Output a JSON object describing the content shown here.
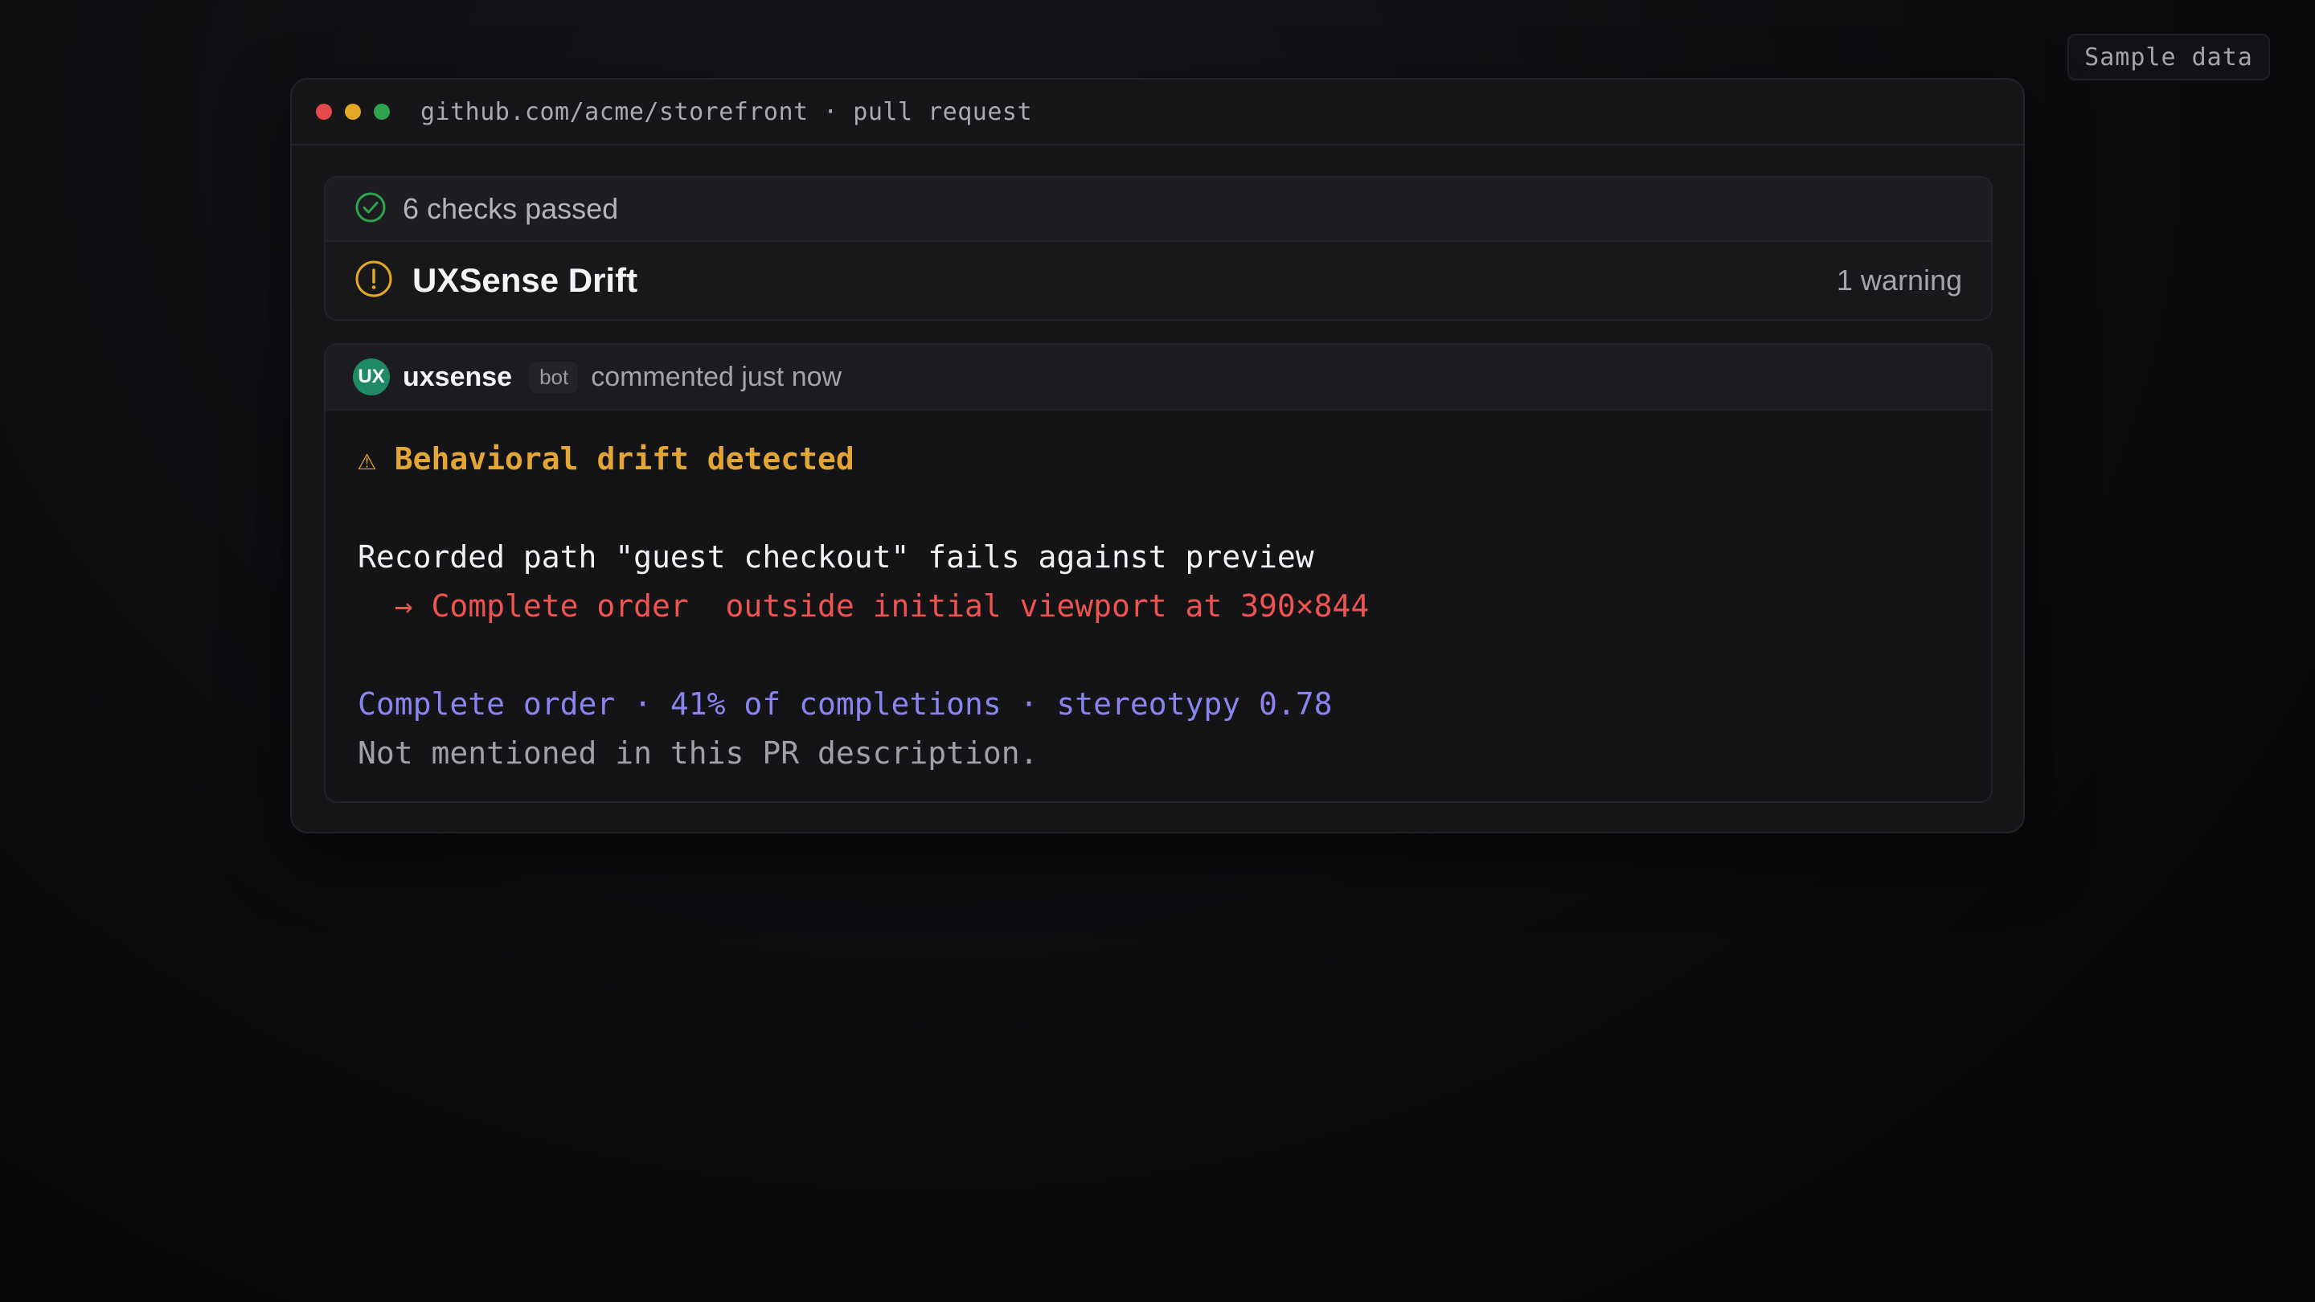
{
  "badge": {
    "label": "Sample data"
  },
  "window": {
    "url": "github.com/acme/storefront · pull request"
  },
  "checks": {
    "passed_label": "6 checks passed",
    "drift_title": "UXSense Drift",
    "warning_count": "1 warning",
    "colors": {
      "success": "#2ea44f",
      "warning": "#e5a823"
    }
  },
  "comment": {
    "avatar_text": "UX",
    "author": "uxsense",
    "tag": "bot",
    "meta": "commented just now",
    "heading_icon": "⚠",
    "heading": "Behavioral drift detected",
    "recorded_line": "Recorded path \"guest checkout\" fails against preview",
    "arrow_line": "  → Complete order  outside initial viewport at 390×844",
    "stats_line": "Complete order · 41% of completions · stereotypy 0.78",
    "note_line": "Not mentioned in this PR description."
  }
}
